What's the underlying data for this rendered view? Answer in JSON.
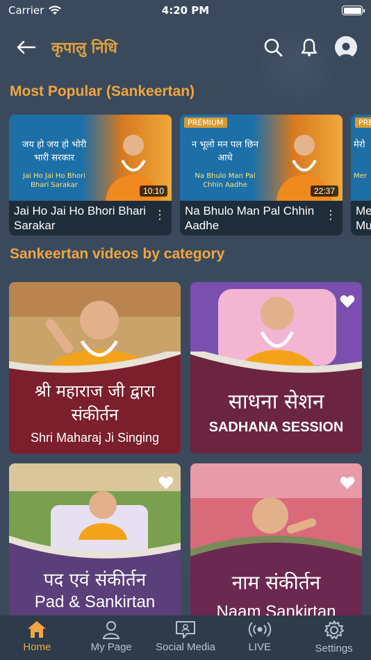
{
  "status_bar": {
    "carrier": "Carrier",
    "time": "4:20 PM"
  },
  "header": {
    "logo_text": "कृपालु निधि",
    "icons": [
      "back-arrow-icon",
      "search-icon",
      "bell-icon",
      "profile-avatar-icon"
    ]
  },
  "sections": {
    "popular_title": "Most Popular (Sankeertan)",
    "category_title": "Sankeertan videos by category"
  },
  "popular": [
    {
      "title": "Jai Ho Jai Ho Bhori Bhari Sarakar",
      "thumb_hindi": "जय हो जय हो भोरी भारी सरकार",
      "thumb_eng": "Jai Ho Jai Ho Bhori Bhari Sarakar",
      "duration": "10:10",
      "premium": ""
    },
    {
      "title": "Na Bhulo Man Pal Chhin Aadhe",
      "thumb_hindi": "न भूलो मन पल छिन आधे",
      "thumb_eng": "Na Bhulo Man Pal Chhin Aadhe",
      "duration": "22:37",
      "premium": "PREMIUM"
    },
    {
      "title": "Me Mu",
      "thumb_hindi": "मेरो",
      "thumb_eng": "Mer",
      "duration": "",
      "premium": "PRE"
    }
  ],
  "categories": [
    {
      "hindi": "श्री महाराज जी द्वारा संकीर्तन",
      "eng": "Shri Maharaj Ji Singing",
      "color": "#7a1f2b"
    },
    {
      "hindi": "साधना सेशन",
      "eng": "SADHANA SESSION",
      "color": "#6b2540"
    },
    {
      "hindi": "पद एवं संकीर्तन",
      "eng": "Pad & Sankirtan",
      "color": "#5b3f7a"
    },
    {
      "hindi": "नाम संकीर्तन",
      "eng": "Naam Sankirtan",
      "color": "#6b2850"
    }
  ],
  "tabs": [
    {
      "label": "Home",
      "icon": "home-icon",
      "active": true
    },
    {
      "label": "My Page",
      "icon": "user-icon",
      "active": false
    },
    {
      "label": "Social Media",
      "icon": "chat-bubble-icon",
      "active": false
    },
    {
      "label": "LIVE",
      "icon": "broadcast-icon",
      "active": false
    },
    {
      "label": "Settings",
      "icon": "gear-icon",
      "active": false
    }
  ],
  "colors": {
    "accent": "#f0a640",
    "background": "#3a4a5c",
    "tab_bar": "#2d3b4b"
  }
}
